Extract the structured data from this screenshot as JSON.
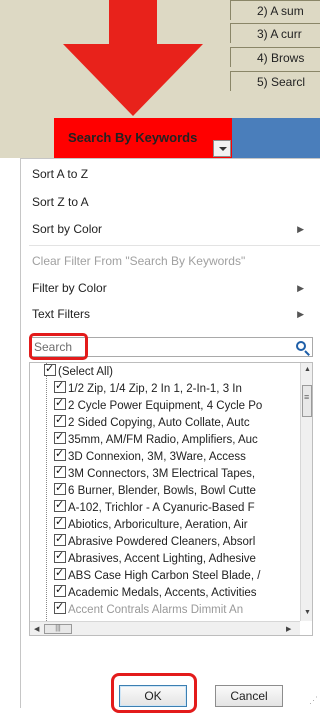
{
  "sheet": {
    "instructions": [
      "2) A sum",
      "3) A curr",
      "4) Brows",
      "5) Searcl"
    ],
    "keyword_header": "Search By Keywords"
  },
  "menu": {
    "sort_az": "Sort A to Z",
    "sort_za": "Sort Z to A",
    "sort_color": "Sort by Color",
    "clear_filter": "Clear Filter From \"Search By Keywords\"",
    "filter_color": "Filter by Color",
    "text_filters": "Text Filters",
    "search_placeholder": "Search",
    "items": [
      "(Select All)",
      "1/2 Zip, 1/4 Zip, 2 In 1, 2-In-1, 3 In",
      "2 Cycle Power Equipment, 4 Cycle Po",
      "2 Sided Copying,  Auto Collate, Autc",
      "35mm, AM/FM Radio, Amplifiers, Auc",
      "3D Connexion, 3M, 3Ware, Access",
      "3M Connectors, 3M Electrical Tapes,",
      "6 Burner, Blender, Bowls, Bowl Cutte",
      "A-102, Trichlor - A Cyanuric-Based F",
      "Abiotics, Arboriculture, Aeration, Air",
      "Abrasive Powdered Cleaners, Absorl",
      "Abrasives, Accent Lighting, Adhesive",
      "ABS Case High Carbon Steel Blade, /",
      "Academic Medals, Accents, Activities",
      "Accent Contrals Alarms Dimmit An"
    ],
    "ok_label": "OK",
    "cancel_label": "Cancel"
  },
  "colors": {
    "highlight": "#e31b1b",
    "arrow": "#e8221b",
    "header_cell": "#ff0000",
    "blue_cell": "#4a7ebb",
    "beige": "#ddd9c4"
  }
}
